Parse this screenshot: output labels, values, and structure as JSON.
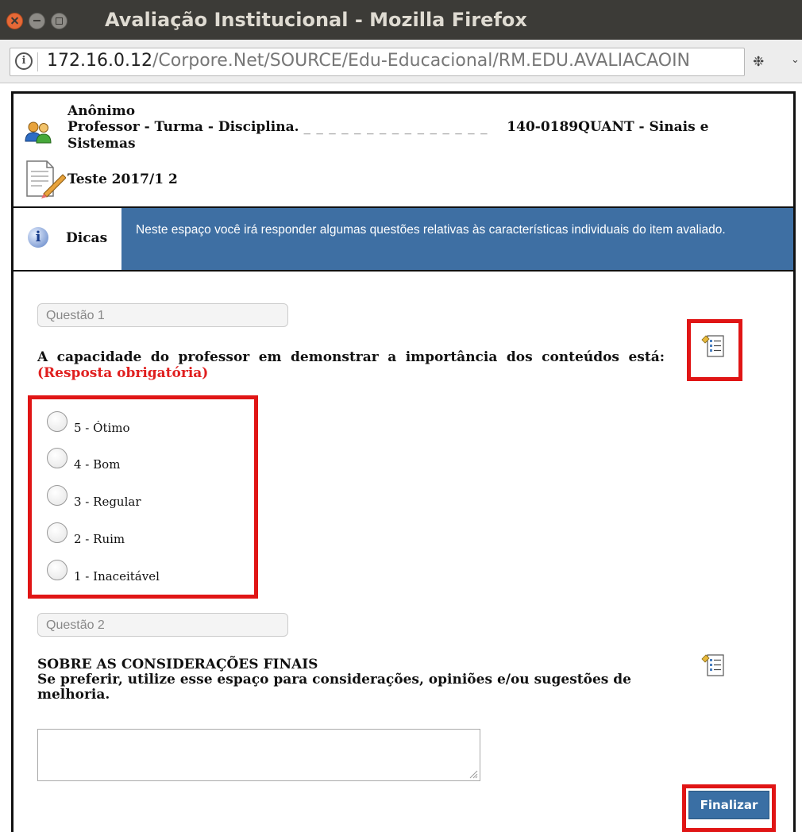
{
  "window": {
    "title": "Avaliação Institucional - Mozilla Firefox"
  },
  "urlbar": {
    "host": "172.16.0.12",
    "path": "/Corpore.Net/SOURCE/Edu-Educacional/RM.EDU.AVALIACAOIN"
  },
  "header": {
    "name": "Anônimo",
    "line2_prefix": "Professor - Turma - Disciplina.",
    "line2_redacted": "_ _ _ _ _ _ _ _   _ _ _ _ _ _ _",
    "line2_suffix": "140-0189QUANT - Sinais e Sistemas",
    "test_name": "Teste 2017/1 2"
  },
  "tips": {
    "label": "Dicas",
    "text": "Neste espaço você irá responder algumas questões relativas às características individuais do item avaliado."
  },
  "question1": {
    "label": "Questão 1",
    "text": "A capacidade do professor em demonstrar a importância dos conteúdos está:",
    "required": "(Resposta obrigatória)",
    "options": [
      {
        "label": "5 - Ótimo"
      },
      {
        "label": "4 - Bom"
      },
      {
        "label": "3 - Regular"
      },
      {
        "label": "2 - Ruim"
      },
      {
        "label": "1 - Inaceitável"
      }
    ]
  },
  "question2": {
    "label": "Questão 2",
    "title": "SOBRE AS CONSIDERAÇÕES FINAIS",
    "text": "Se preferir, utilize esse espaço para considerações, opiniões e/ou sugestões de melhoria.",
    "textarea_value": ""
  },
  "buttons": {
    "finalize": "Finalizar"
  },
  "colors": {
    "tips_background": "#3e6fa3",
    "required_text": "#e02020",
    "highlight": "#e01515",
    "finalize_button": "#3a6fa4"
  }
}
